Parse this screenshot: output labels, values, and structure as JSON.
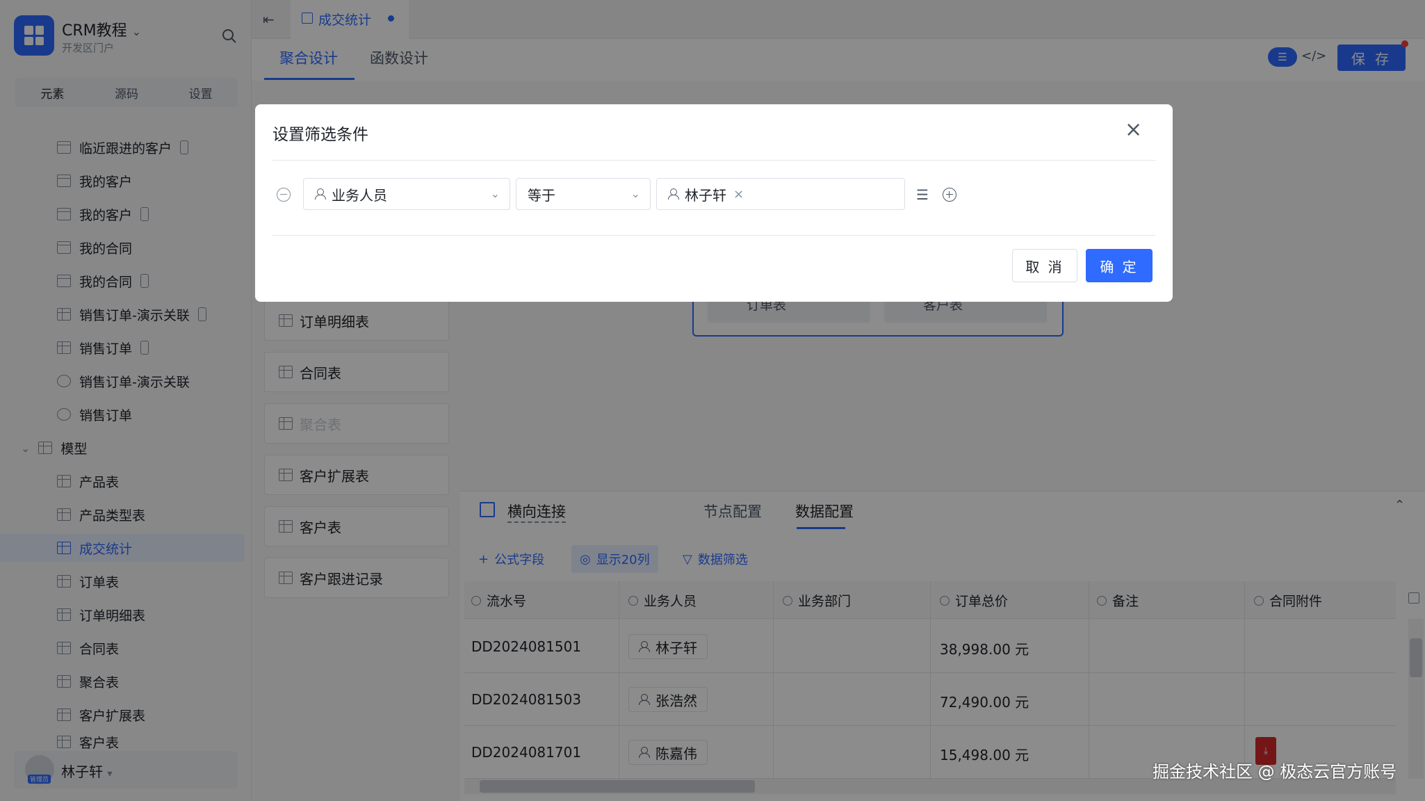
{
  "app": {
    "title": "CRM教程",
    "subtitle": "开发区门户"
  },
  "sidebar": {
    "tabs": [
      "元素",
      "源码",
      "设置"
    ],
    "items": [
      {
        "label": "临近跟进的客户",
        "icon": "form-icon",
        "mobile": true
      },
      {
        "label": "我的客户",
        "icon": "form-icon",
        "mobile": false
      },
      {
        "label": "我的客户",
        "icon": "form-icon",
        "mobile": true
      },
      {
        "label": "我的合同",
        "icon": "form-icon",
        "mobile": false
      },
      {
        "label": "我的合同",
        "icon": "form-icon",
        "mobile": true
      },
      {
        "label": "销售订单-演示关联",
        "icon": "table-icon",
        "mobile": true
      },
      {
        "label": "销售订单",
        "icon": "table-icon",
        "mobile": true
      },
      {
        "label": "销售订单-演示关联",
        "icon": "chart-icon",
        "mobile": false
      },
      {
        "label": "销售订单",
        "icon": "chart-icon",
        "mobile": false
      }
    ],
    "group_label": "模型",
    "model_items": [
      "产品表",
      "产品类型表",
      "成交统计",
      "订单表",
      "订单明细表",
      "合同表",
      "聚合表",
      "客户扩展表",
      "客户表"
    ],
    "selected_model": "成交统计",
    "user_name": "林子轩",
    "user_role": "管理员"
  },
  "header": {
    "tab_label": "成交统计",
    "design_tabs": [
      "聚合设计",
      "函数设计"
    ],
    "save_label": "保 存"
  },
  "models": [
    "订单明细表",
    "合同表",
    "聚合表",
    "客户扩展表",
    "客户表",
    "客户跟进记录"
  ],
  "canvas": {
    "join_chips": [
      "订单表",
      "客户表"
    ]
  },
  "panel": {
    "node_label": "横向连接",
    "tabs": [
      "节点配置",
      "数据配置"
    ],
    "tools": [
      "公式字段",
      "显示20列",
      "数据筛选"
    ],
    "columns": [
      "流水号",
      "业务人员",
      "业务部门",
      "订单总价",
      "备注",
      "合同附件"
    ],
    "rows": [
      {
        "serial": "DD2024081501",
        "person": "林子轩",
        "total": "38,998.00 元"
      },
      {
        "serial": "DD2024081503",
        "person": "张浩然",
        "total": "72,490.00 元"
      },
      {
        "serial": "DD2024081701",
        "person": "陈嘉伟",
        "total": "15,498.00 元"
      }
    ]
  },
  "modal": {
    "title": "设置筛选条件",
    "field": "业务人员",
    "operator": "等于",
    "value": "林子轩",
    "cancel_label": "取 消",
    "ok_label": "确 定"
  },
  "watermark": "掘金技术社区 @ 极态云官方账号",
  "colors": {
    "accent": "#2f6bff",
    "danger": "#f53f3f"
  }
}
